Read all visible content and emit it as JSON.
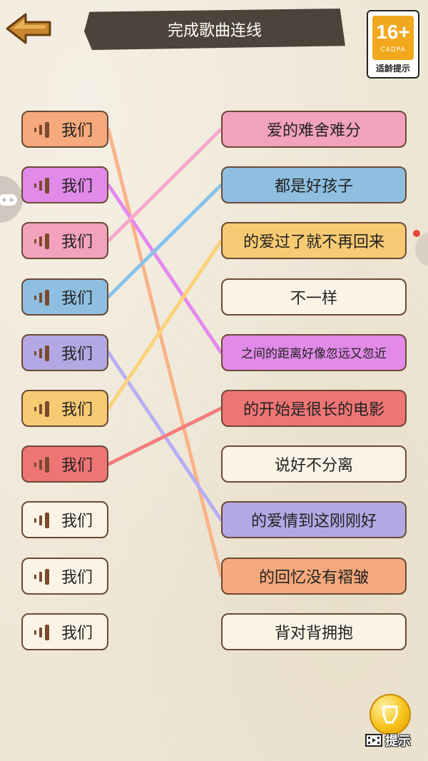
{
  "header": {
    "title": "完成歌曲连线"
  },
  "age_rating": {
    "number": "16+",
    "org": "CADPA",
    "caption": "适龄提示"
  },
  "left_items": [
    {
      "label": "我们",
      "color": "#f5a97c"
    },
    {
      "label": "我们",
      "color": "#e18ae8"
    },
    {
      "label": "我们",
      "color": "#f2a2bd"
    },
    {
      "label": "我们",
      "color": "#8ebfe0"
    },
    {
      "label": "我们",
      "color": "#b4a8e4"
    },
    {
      "label": "我们",
      "color": "#f8ca73"
    },
    {
      "label": "我们",
      "color": "#ee7575"
    },
    {
      "label": "我们",
      "color": "#fbf4e6"
    },
    {
      "label": "我们",
      "color": "#fbf4e6"
    },
    {
      "label": "我们",
      "color": "#fbf4e6"
    }
  ],
  "right_items": [
    {
      "label": "爱的难舍难分",
      "color": "#f2a2bd"
    },
    {
      "label": "都是好孩子",
      "color": "#8ebfe0"
    },
    {
      "label": "的爱过了就不再回来",
      "color": "#f8ca73"
    },
    {
      "label": "不一样",
      "color": "#fbf4e6"
    },
    {
      "label": "之间的距离好像忽远又忽近",
      "color": "#e18ae8"
    },
    {
      "label": "的开始是很长的电影",
      "color": "#ee7575"
    },
    {
      "label": "说好不分离",
      "color": "#fbf4e6"
    },
    {
      "label": "的爱情到这刚刚好",
      "color": "#b4a8e4"
    },
    {
      "label": "的回忆没有褶皱",
      "color": "#f5a97c"
    },
    {
      "label": "背对背拥抱",
      "color": "#fbf4e6"
    }
  ],
  "connections": [
    {
      "from": 0,
      "to": 8,
      "color": "#f9b389"
    },
    {
      "from": 1,
      "to": 4,
      "color": "#e488ef"
    },
    {
      "from": 2,
      "to": 0,
      "color": "#f6a8c8"
    },
    {
      "from": 3,
      "to": 1,
      "color": "#86c2ec"
    },
    {
      "from": 4,
      "to": 7,
      "color": "#b7aef5"
    },
    {
      "from": 5,
      "to": 2,
      "color": "#fbd27a"
    },
    {
      "from": 6,
      "to": 5,
      "color": "#f27d7d"
    }
  ],
  "hint": {
    "label": "提示"
  },
  "icons": {
    "back": "back-arrow-icon",
    "sound": "sound-wave-icon",
    "gamepad": "gamepad-icon",
    "hint": "lightbulb-coin-icon",
    "video": "video-film-icon"
  }
}
